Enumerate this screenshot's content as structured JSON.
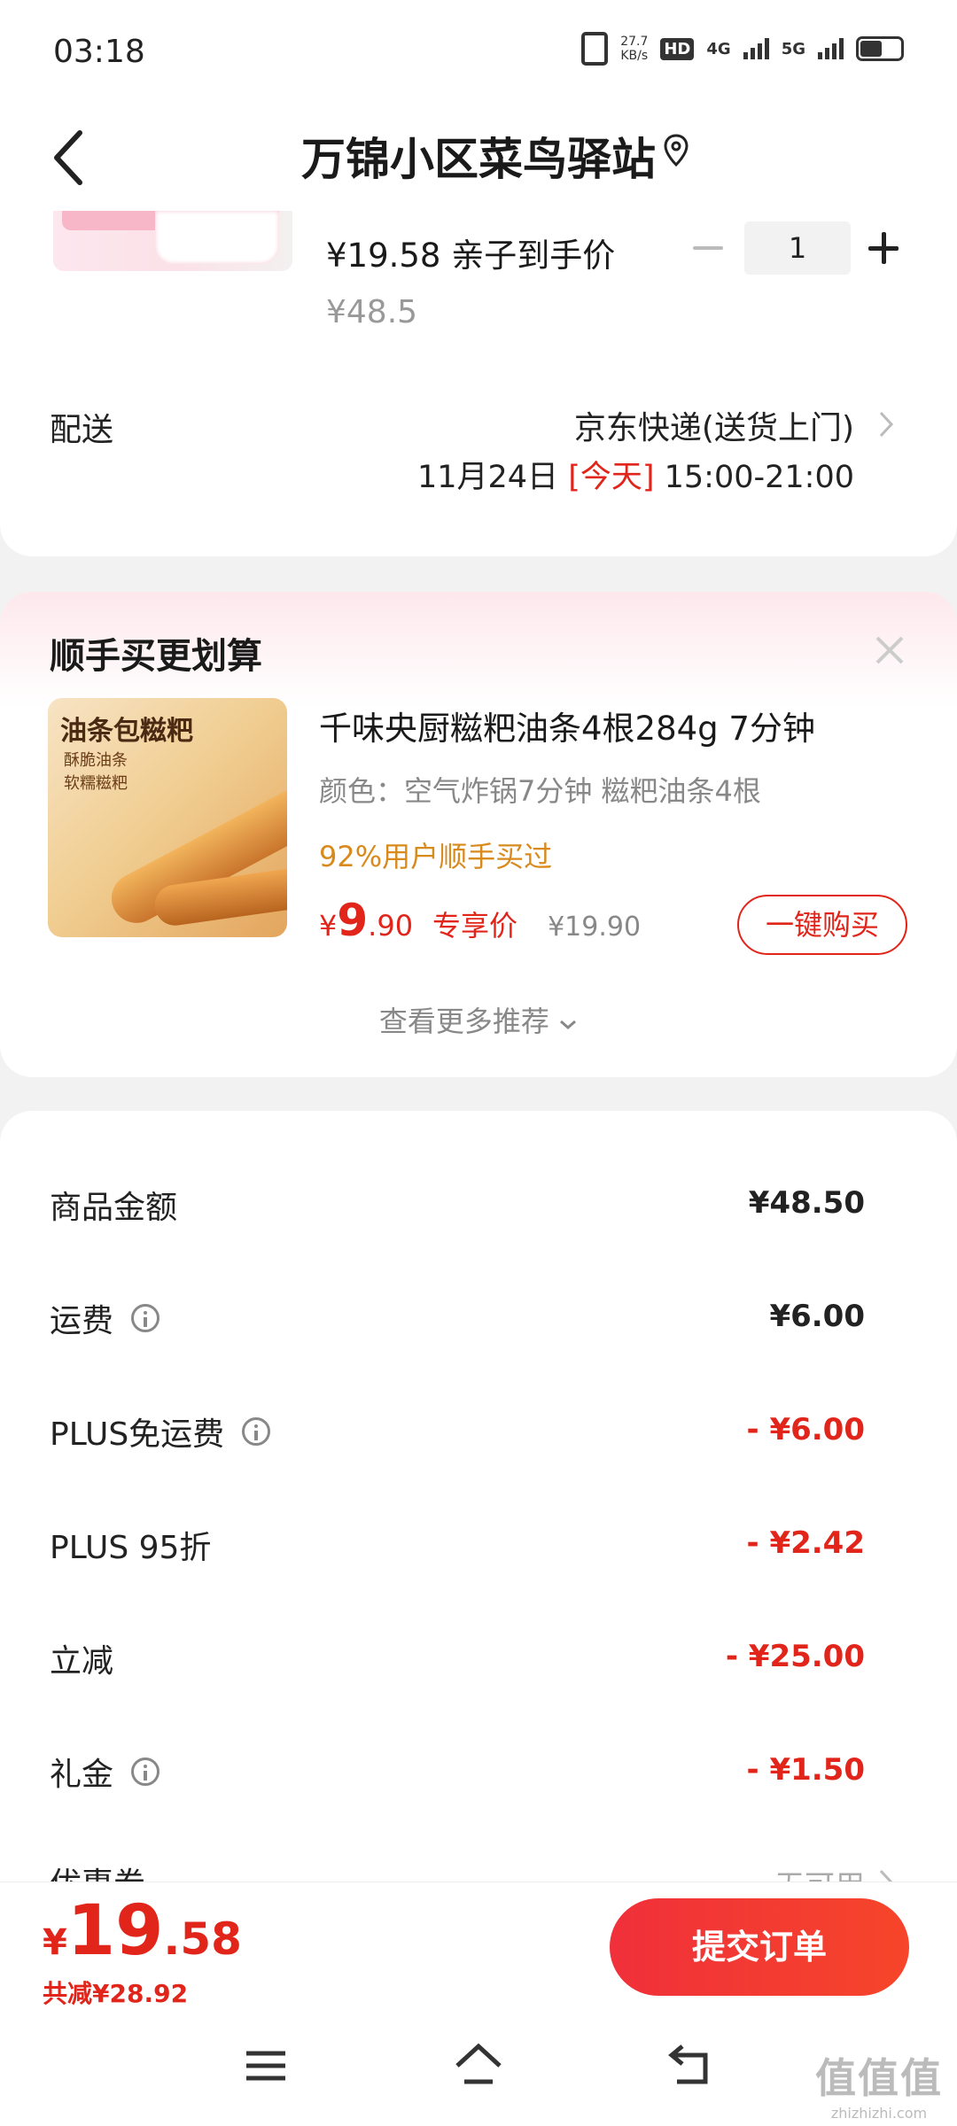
{
  "status_bar": {
    "time": "03:18",
    "net_speed": "27.7",
    "net_speed_unit": "KB/s",
    "hd_label": "HD",
    "net_4g": "4G",
    "net_5g": "5G"
  },
  "header": {
    "title": "万锦小区菜鸟驿站"
  },
  "product": {
    "price_text": "¥19.58 亲子到手价",
    "original_price": "¥48.5",
    "quantity": "1"
  },
  "delivery": {
    "label": "配送",
    "method": "京东快递(送货上门)",
    "date": "11月24日",
    "today": "[今天]",
    "time_range": "15:00-21:00"
  },
  "recommendation": {
    "title": "顺手买更划算",
    "image_label": "油条包糍粑",
    "image_subtitle_1": "酥脆油条",
    "image_subtitle_2": "软糯糍粑",
    "product_name": "千味央厨糍粑油条4根284g 7分钟",
    "spec": "颜色：空气炸锅7分钟 糍粑油条4根",
    "bought_rate": "92%用户顺手买过",
    "price_symbol": "¥",
    "price_int": "9",
    "price_dec": ".90",
    "price_tag": "专享价",
    "original_price": "¥19.90",
    "buy_label": "一键购买",
    "more_label": "查看更多推荐"
  },
  "breakdown": {
    "rows": [
      {
        "label": "商品金额",
        "value": "¥48.50"
      },
      {
        "label": "运费",
        "value": "¥6.00"
      },
      {
        "label": "PLUS免运费",
        "value": "- ¥6.00"
      },
      {
        "label": "PLUS 95折",
        "value": "- ¥2.42"
      },
      {
        "label": "立减",
        "value": "- ¥25.00"
      },
      {
        "label": "礼金",
        "value": "- ¥1.50"
      },
      {
        "label": "优惠券",
        "value": "无可用"
      }
    ]
  },
  "checkout": {
    "total_symbol": "¥",
    "total_int": "19",
    "total_dec": ".58",
    "saved": "共减¥28.92",
    "submit_label": "提交订单"
  },
  "watermark": {
    "logo": "值值值",
    "url": "zhizhizhi.com"
  },
  "colors": {
    "accent_red": "#e1251b",
    "orange": "#d98a1d",
    "background": "#f2f2f2"
  },
  "icons": [
    "back-arrow-icon",
    "location-pin-icon",
    "minus-icon",
    "plus-icon",
    "chevron-right-icon",
    "close-icon",
    "chevron-down-icon",
    "info-icon",
    "menu-icon",
    "home-icon",
    "return-icon"
  ]
}
